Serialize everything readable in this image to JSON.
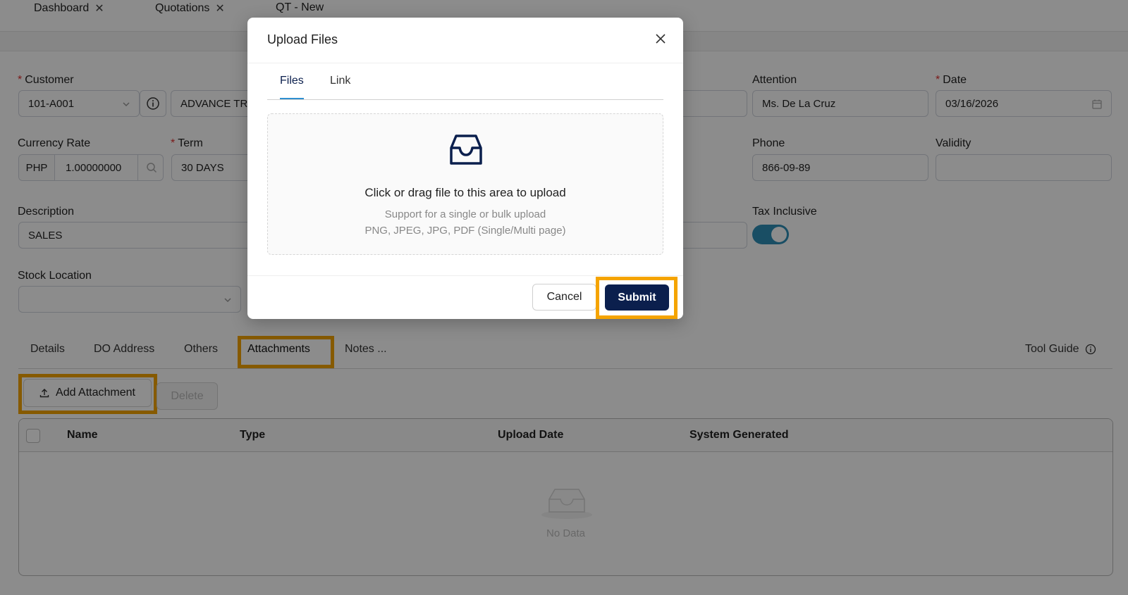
{
  "top_tabs": [
    {
      "label": "Dashboard",
      "close": "✕"
    },
    {
      "label": "Quotations",
      "close": "✕"
    },
    {
      "label": "QT - New"
    }
  ],
  "form": {
    "customer_label": "Customer",
    "customer_code": "101-A001",
    "customer_name": "ADVANCE TR",
    "attention_label": "Attention",
    "attention_value": "Ms. De La Cruz",
    "date_label": "Date",
    "date_value": "03/16/2026",
    "currency_label": "Currency Rate",
    "currency_code": "PHP",
    "currency_rate": "1.00000000",
    "term_label": "Term",
    "term_value": "30 DAYS",
    "phone_label": "Phone",
    "phone_value": "866-09-89",
    "validity_label": "Validity",
    "validity_value": "",
    "description_label": "Description",
    "description_value": "SALES",
    "tax_inclusive_label": "Tax Inclusive",
    "tax_inclusive_on": true,
    "stock_location_label": "Stock Location",
    "stock_location_value": ""
  },
  "bottom_tabs": [
    "Details",
    "DO Address",
    "Others",
    "Attachments",
    "Notes ..."
  ],
  "active_bottom_tab": "Attachments",
  "tool_guide_label": "Tool Guide",
  "actions": {
    "add_attachment": "Add Attachment",
    "delete": "Delete"
  },
  "table": {
    "columns": [
      "Name",
      "Type",
      "Upload Date",
      "System Generated"
    ],
    "empty_text": "No Data"
  },
  "modal": {
    "title": "Upload Files",
    "tabs": [
      "Files",
      "Link"
    ],
    "active_tab": "Files",
    "drop_text": "Click or drag file to this area to upload",
    "drop_hint_1": "Support for a single or bulk upload",
    "drop_hint_2": "PNG, JPEG, JPG, PDF (Single/Multi page)",
    "cancel": "Cancel",
    "submit": "Submit"
  },
  "colors": {
    "highlight": "#f5a400",
    "primary": "#0b1f4d",
    "accent": "#2f8fd0",
    "toggle": "#2f8fb7",
    "required": "#e03131"
  }
}
